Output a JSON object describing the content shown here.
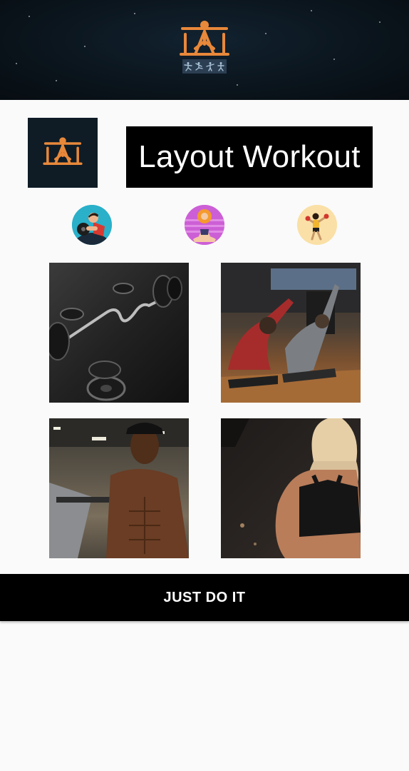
{
  "header": {
    "logo_icon": "weightlifter-logo-icon",
    "stripe_icons": [
      "dancer-icon",
      "dancer-icon",
      "dancer-icon",
      "dancer-icon"
    ]
  },
  "layout_logo_icon": "weightlifter-logo-icon",
  "title": "Layout Workout",
  "categories": [
    {
      "icon": "boxer-cartoon-icon",
      "accent": "#2ab0c9"
    },
    {
      "icon": "yoga-meditation-icon",
      "accent": "#cc5fd6"
    },
    {
      "icon": "boxer-icon",
      "accent": "#fae0a7"
    }
  ],
  "photos": [
    {
      "name": "barbell-photo"
    },
    {
      "name": "stretching-class-photo"
    },
    {
      "name": "muscular-man-photo"
    },
    {
      "name": "woman-back-photo"
    }
  ],
  "cta": {
    "label": "JUST DO IT"
  },
  "colors": {
    "logo_accent": "#e8883a",
    "header_bg": "#0b151d",
    "button_bg": "#000000"
  }
}
